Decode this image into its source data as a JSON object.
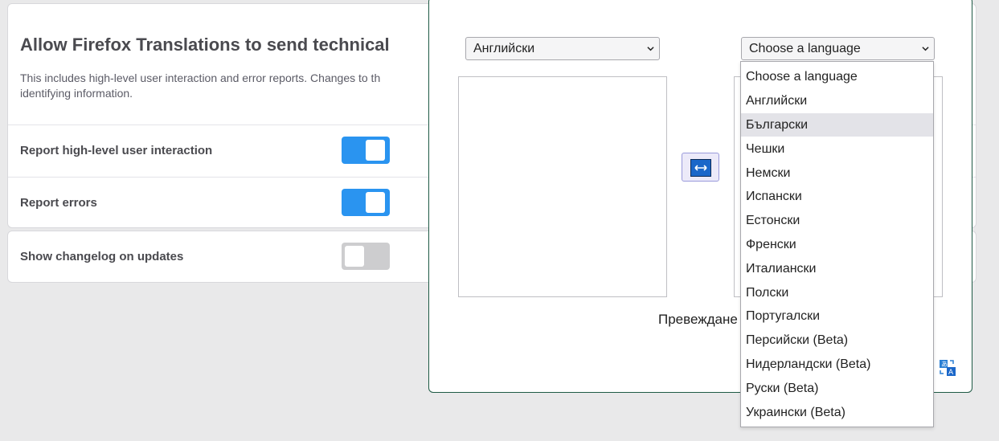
{
  "settings": {
    "telemetry_title": "Allow Firefox Translations to send technical",
    "telemetry_desc": "This includes high-level user interaction and error reports. Changes to th identifying information.",
    "rows": [
      {
        "label": "Report high-level user interaction",
        "enabled": true
      },
      {
        "label": "Report errors",
        "enabled": true
      }
    ],
    "changelog": {
      "label": "Show changelog on updates",
      "enabled": false
    }
  },
  "popup": {
    "source_language": "Английски",
    "target_language": "Choose a language",
    "translate_status": "Превеждане"
  },
  "dropdown": {
    "options": [
      "Choose a language",
      "Английски",
      "Български",
      "Чешки",
      "Немски",
      "Испански",
      "Естонски",
      "Френски",
      "Италиански",
      "Полски",
      "Португалски",
      "Персийски (Beta)",
      "Нидерландски (Beta)",
      "Руски (Beta)",
      "Украински (Beta)"
    ],
    "highlighted": "Български"
  },
  "colors": {
    "toggle_on": "#2a94f0",
    "toggle_off": "#cdcdcf",
    "popup_border": "#1f5a45",
    "swap_icon": "#1b67c9"
  },
  "icons": [
    "swap-languages-icon",
    "chevron-down-icon",
    "translate-icon"
  ]
}
